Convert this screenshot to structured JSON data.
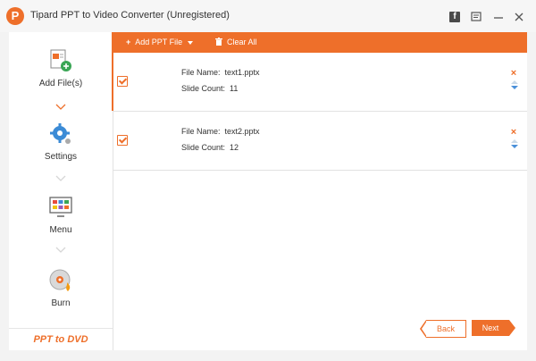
{
  "window": {
    "title": "Tipard PPT to Video Converter (Unregistered)",
    "logo_letter": "P"
  },
  "titlebar_icons": [
    "facebook-icon",
    "feedback-icon",
    "minimize-icon",
    "close-icon"
  ],
  "sidebar": {
    "steps": [
      {
        "label": "Add File(s)",
        "icon": "add-file-icon",
        "active": true
      },
      {
        "label": "Settings",
        "icon": "gear-icon",
        "active": false
      },
      {
        "label": "Menu",
        "icon": "menu-screen-icon",
        "active": false
      },
      {
        "label": "Burn",
        "icon": "disc-burn-icon",
        "active": false
      }
    ],
    "brand": "PPT to DVD"
  },
  "toolbar": {
    "add_label": "Add PPT File",
    "clear_label": "Clear All"
  },
  "files": [
    {
      "name_label": "File Name:",
      "name": "text1.pptx",
      "count_label": "Slide Count:",
      "count": "11",
      "checked": true
    },
    {
      "name_label": "File Name:",
      "name": "text2.pptx",
      "count_label": "Slide Count:",
      "count": "12",
      "checked": true
    }
  ],
  "nav": {
    "back_label": "Back",
    "next_label": "Next"
  },
  "colors": {
    "accent": "#ee6f2a",
    "arrow_blue": "#4a90d9"
  }
}
